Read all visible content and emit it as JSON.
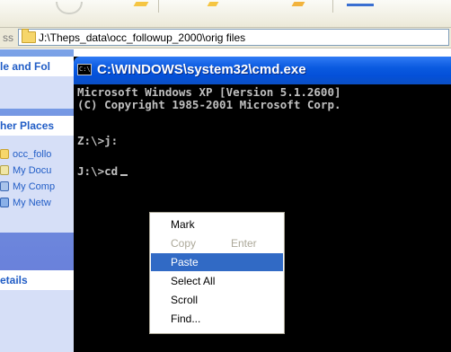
{
  "explorer": {
    "address_label": "ss",
    "address_path": "J:\\Theps_data\\occ_followup_2000\\orig files",
    "task_pane": {
      "file_folder_header": "le and Fol",
      "other_places_header": "her Places",
      "other_places_items": [
        {
          "label": "occ_follo",
          "icon": "folder-icon"
        },
        {
          "label": "My Docu",
          "icon": "documents-icon"
        },
        {
          "label": "My Comp",
          "icon": "computer-icon"
        },
        {
          "label": "My Netw",
          "icon": "network-icon"
        }
      ],
      "details_header": "etails"
    }
  },
  "cmd": {
    "icon_text": "C:\\",
    "title": "C:\\WINDOWS\\system32\\cmd.exe",
    "lines": [
      "Microsoft Windows XP [Version 5.1.2600]",
      "(C) Copyright 1985-2001 Microsoft Corp.",
      "",
      "Z:\\>j:",
      "",
      "J:\\>cd"
    ]
  },
  "context_menu": {
    "items": [
      {
        "label": "Mark",
        "state": "normal",
        "accel": ""
      },
      {
        "label": "Copy",
        "state": "disabled",
        "accel": "Enter"
      },
      {
        "label": "Paste",
        "state": "highlighted",
        "accel": ""
      },
      {
        "label": "Select All",
        "state": "normal",
        "accel": ""
      },
      {
        "label": "Scroll",
        "state": "normal",
        "accel": ""
      },
      {
        "label": "Find...",
        "state": "normal",
        "accel": ""
      }
    ]
  },
  "colors": {
    "titlebar": "#0a5ae0",
    "console_bg": "#000000",
    "console_text": "#c0c0c0",
    "menu_highlight": "#316ac5",
    "task_pane_link": "#215dc6"
  }
}
